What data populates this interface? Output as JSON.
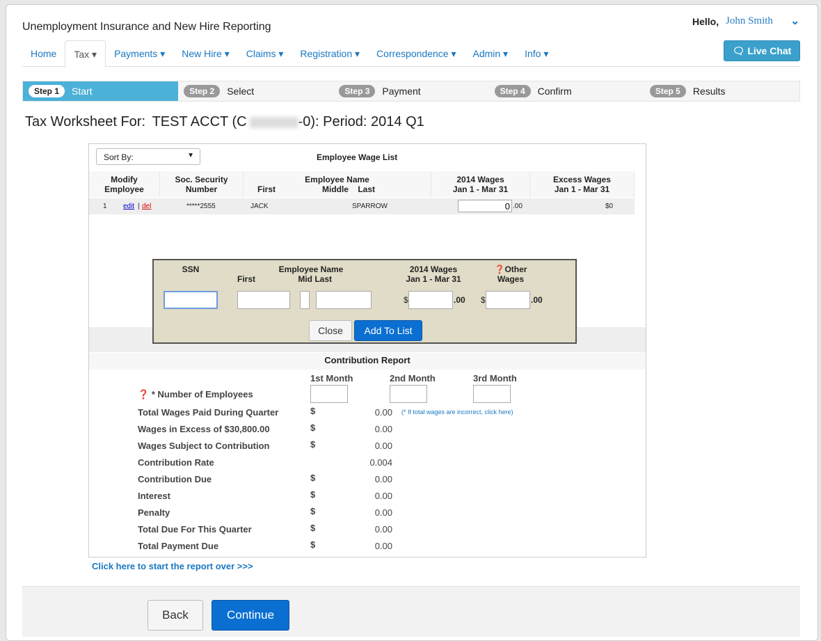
{
  "header": {
    "app_title": "Unemployment Insurance and New Hire Reporting",
    "hello": "Hello,",
    "user": "John Smith",
    "chevron": "chevron-down-icon",
    "live_chat": "Live Chat"
  },
  "nav": [
    {
      "label": "Home"
    },
    {
      "label": "Tax ▾"
    },
    {
      "label": "Payments ▾"
    },
    {
      "label": "New Hire ▾"
    },
    {
      "label": "Claims ▾"
    },
    {
      "label": "Registration ▾"
    },
    {
      "label": "Correspondence ▾"
    },
    {
      "label": "Admin ▾"
    },
    {
      "label": "Info ▾"
    }
  ],
  "steps": [
    {
      "badge": "Step 1",
      "label": "Start"
    },
    {
      "badge": "Step 2",
      "label": "Select"
    },
    {
      "badge": "Step 3",
      "label": "Payment"
    },
    {
      "badge": "Step 4",
      "label": "Confirm"
    },
    {
      "badge": "Step 5",
      "label": "Results"
    }
  ],
  "page_title": {
    "prefix": "Tax Worksheet For:",
    "acct": "TEST ACCT  (C",
    "suffix": "-0): Period: 2014 Q1"
  },
  "wage_list": {
    "sort_by": "Sort By:",
    "title": "Employee Wage List",
    "headers": {
      "modify": "Modify\nEmployee",
      "ssn": "Soc. Security\nNumber",
      "name": "Employee Name",
      "first": "First",
      "middle_last": "Middle    Last",
      "wages": "2014 Wages\nJan 1 - Mar 31",
      "excess": "Excess Wages\nJan 1 - Mar 31"
    },
    "rows": [
      {
        "num": "1",
        "edit": "edit",
        "sep": "|",
        "del": "del",
        "ssn": "*****2555",
        "first": "JACK",
        "last": "SPARROW",
        "wages": "0",
        "cents": ".00",
        "excess": "$0"
      }
    ]
  },
  "modal": {
    "ssn": "SSN",
    "name": "Employee Name",
    "first": "First",
    "mid_last": "Mid Last",
    "wages": "2014 Wages\nJan 1 - Mar 31",
    "other": "Other\nWages",
    "dollar": "$",
    "cents": ".00",
    "close": "Close",
    "add": "Add To List"
  },
  "report": {
    "title": "Contribution Report",
    "months": [
      "1st Month",
      "2nd Month",
      "3rd Month"
    ],
    "num_employees": "* Number of Employees",
    "rows": [
      {
        "label": "Total Wages Paid During Quarter",
        "dollar": "$",
        "value": "0.00"
      },
      {
        "label": "Wages in Excess of $30,800.00",
        "dollar": "$",
        "value": "0.00"
      },
      {
        "label": "Wages Subject to Contribution",
        "dollar": "$",
        "value": "0.00"
      },
      {
        "label": "Contribution Rate",
        "dollar": "",
        "value": "0.004"
      },
      {
        "label": "Contribution Due",
        "dollar": "$",
        "value": "0.00"
      },
      {
        "label": "Interest",
        "dollar": "$",
        "value": "0.00"
      },
      {
        "label": "Penalty",
        "dollar": "$",
        "value": "0.00"
      },
      {
        "label": "Total Due For This Quarter",
        "dollar": "$",
        "value": "0.00"
      },
      {
        "label": "Total Payment Due",
        "dollar": "$",
        "value": "0.00"
      }
    ],
    "note": "(* If total wages are incorrect, click here)",
    "restart": "Click here to start the report over >>>"
  },
  "footer": {
    "back": "Back",
    "continue": "Continue"
  }
}
